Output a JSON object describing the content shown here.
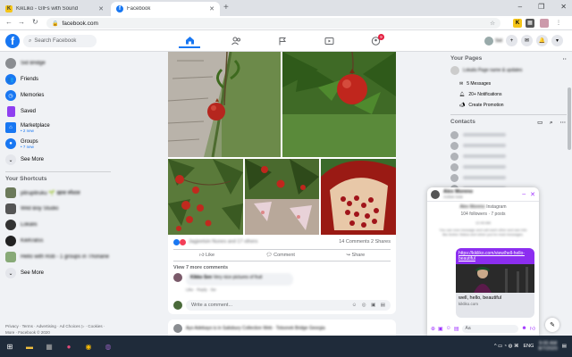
{
  "browser": {
    "tabs": [
      {
        "title": "KikLiko - GIFs with Sound",
        "favicon_color": "#f5c518",
        "favicon_text": "K"
      },
      {
        "title": "Facebook",
        "favicon_color": "#1877f2",
        "favicon_text": "f"
      }
    ],
    "url": "facebook.com",
    "new_tab": "+",
    "controls": {
      "min": "–",
      "max": "❐",
      "close": "✕"
    }
  },
  "fb": {
    "logo": "f",
    "search_placeholder": "Search Facebook",
    "notification_badge": "9",
    "profile_name": "Sid"
  },
  "left_nav": {
    "profile": "Sid Bridge",
    "items": [
      {
        "label": "Friends",
        "icon": "friends-icon",
        "color": "#1877f2"
      },
      {
        "label": "Memories",
        "icon": "memories-icon",
        "color": "#1877f2"
      },
      {
        "label": "Saved",
        "icon": "saved-icon",
        "color": "#8f3ff0"
      },
      {
        "label": "Marketplace",
        "sub": "• 2 new",
        "icon": "marketplace-icon",
        "color": "#1877f2"
      },
      {
        "label": "Groups",
        "sub": "• 7 new",
        "icon": "groups-icon",
        "color": "#1877f2"
      },
      {
        "label": "See More",
        "icon": "chevron-down-icon",
        "color": "#e4e6eb"
      }
    ],
    "shortcuts_title": "Your Shortcuts",
    "shortcuts": [
      {
        "label": "pitrupitruku 🌱 ख़ास स्पेशल"
      },
      {
        "label": "Wild Boy Studio"
      },
      {
        "label": "Lokalis"
      },
      {
        "label": "KikKratss"
      },
      {
        "label": "Hello with Rob - 1 groups in Thonane"
      }
    ],
    "shortcuts_more": "See More",
    "footer": "Privacy · Terms · Advertising · Ad Choices ▷ · Cookies · More · Facebook © 2020"
  },
  "post": {
    "reactions_blur": "Jagjeetsin Nunes and 17 others",
    "comments_shares": "14 Comments  2 Shares",
    "like": "Like",
    "comment": "Comment",
    "share": "Share",
    "view_comments": "View 7 more comments",
    "comment_author": "Kikko Sen",
    "comment_text": "Very nice pictures of fruit",
    "comment_meta": "Like · Reply · 5w",
    "write_comment": "Write a comment...",
    "next_post_author": "Ayo Adebayo is in Salisbury Collection Web · Tolsonek Bridge Georgia"
  },
  "right_panel": {
    "pages_title": "Your Pages",
    "page_name": "Lokalis Page name & updates",
    "page_items": [
      {
        "label": "5 Messages",
        "icon": "messages-icon"
      },
      {
        "label": "20+ Notifications",
        "icon": "bell-icon"
      },
      {
        "label": "Create Promotion",
        "icon": "megaphone-icon"
      }
    ],
    "contacts_title": "Contacts",
    "contacts_count": 8
  },
  "chat": {
    "name": "Alex Moreno",
    "status": "Active now",
    "profile_name": "Alex Moreno",
    "platform": "Instagram",
    "followers": "104 followers · 7 posts",
    "time": "12:49 AM",
    "info": "You can now message and call each other and see info like Active Status and when you've read messages.",
    "link": "https://kikliko.com/view/hell-hello-beautiful",
    "link_caption": "well, hello, beautiful",
    "link_domain": "kikliko.com",
    "input_placeholder": "Aa"
  },
  "taskbar": {
    "lang": "ENG",
    "time": "9:00 AM",
    "date": "8/7/2020"
  }
}
